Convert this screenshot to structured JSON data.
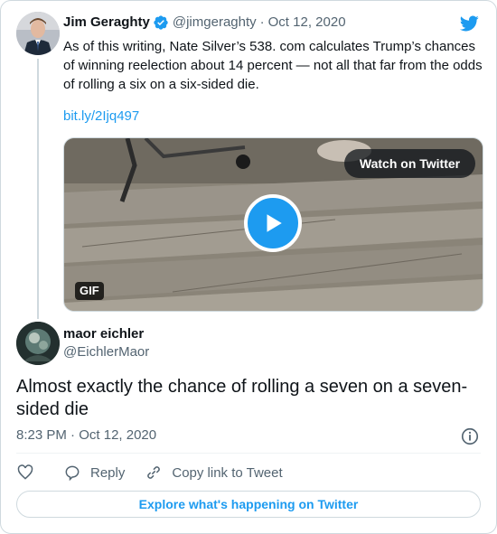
{
  "quoted_tweet": {
    "author_name": "Jim Geraghty",
    "handle": "@jimgeraghty",
    "separator": "·",
    "date": "Oct 12, 2020",
    "text": "As of this writing, Nate Silver’s 538. com calculates Trump’s chances of winning reelection about 14 percent — not all that far from the odds of rolling a six on a six-sided die.",
    "link": "bit.ly/2Ijq497",
    "media": {
      "watch_label": "Watch on Twitter",
      "gif_label": "GIF"
    }
  },
  "reply_tweet": {
    "author_name": "maor eichler",
    "handle": "@EichlerMaor",
    "text": "Almost exactly the chance of rolling a seven on a seven-sided die",
    "time": "8:23 PM",
    "separator": "·",
    "date": "Oct 12, 2020"
  },
  "actions": {
    "reply_label": "Reply",
    "copy_link_label": "Copy link to Tweet"
  },
  "explore_label": "Explore what's happening on Twitter",
  "colors": {
    "accent": "#1d9bf0",
    "text_primary": "#0f1419",
    "text_secondary": "#536471",
    "border": "#cfd9de"
  },
  "icons": [
    "verified-badge-icon",
    "twitter-logo-icon",
    "play-icon",
    "info-icon",
    "heart-icon",
    "reply-icon",
    "link-icon"
  ]
}
